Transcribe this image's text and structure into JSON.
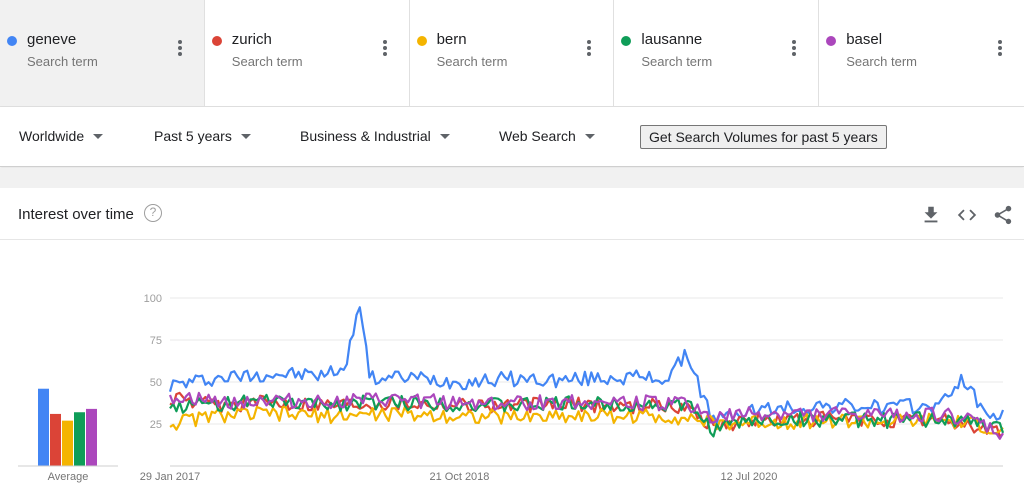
{
  "terms": [
    {
      "name": "geneve",
      "sub": "Search term",
      "color": "#4285f4"
    },
    {
      "name": "zurich",
      "sub": "Search term",
      "color": "#db4437"
    },
    {
      "name": "bern",
      "sub": "Search term",
      "color": "#f4b400"
    },
    {
      "name": "lausanne",
      "sub": "Search term",
      "color": "#0f9d58"
    },
    {
      "name": "basel",
      "sub": "Search term",
      "color": "#ab47bc"
    }
  ],
  "filters": {
    "region": "Worldwide",
    "period": "Past 5 years",
    "category": "Business & Industrial",
    "property": "Web Search"
  },
  "volume_button": "Get Search Volumes for past 5 years",
  "card": {
    "title": "Interest over time",
    "help": "?",
    "icons": [
      "download-icon",
      "embed-icon",
      "share-icon"
    ]
  },
  "chart_data": {
    "type": "line",
    "ylim": [
      0,
      100
    ],
    "yticks": [
      25,
      50,
      75,
      100
    ],
    "x_tick_labels": [
      "29 Jan 2017",
      "21 Oct 2018",
      "12 Jul 2020"
    ],
    "x_tick_dates": [
      "2017-01-29",
      "2018-10-21",
      "2020-07-12"
    ],
    "x_start": "2017-01-29",
    "x_end": "2022-01-16",
    "average_label": "Average",
    "averages": [
      {
        "name": "geneve",
        "value": 46
      },
      {
        "name": "zurich",
        "value": 31
      },
      {
        "name": "bern",
        "value": 27
      },
      {
        "name": "lausanne",
        "value": 32
      },
      {
        "name": "basel",
        "value": 34
      }
    ],
    "series": [
      {
        "name": "geneve",
        "color": "#4285f4",
        "points": [
          [
            "2017-01-29",
            48
          ],
          [
            "2017-05-01",
            52
          ],
          [
            "2017-09-01",
            55
          ],
          [
            "2018-01-01",
            54
          ],
          [
            "2018-02-18",
            60
          ],
          [
            "2018-03-15",
            100
          ],
          [
            "2018-04-10",
            52
          ],
          [
            "2018-07-01",
            53
          ],
          [
            "2018-10-21",
            50
          ],
          [
            "2019-02-01",
            52
          ],
          [
            "2019-06-01",
            51
          ],
          [
            "2019-10-01",
            53
          ],
          [
            "2020-01-15",
            52
          ],
          [
            "2020-03-01",
            67
          ],
          [
            "2020-03-22",
            50
          ],
          [
            "2020-04-26",
            27
          ],
          [
            "2020-07-12",
            33
          ],
          [
            "2021-01-01",
            36
          ],
          [
            "2021-05-01",
            35
          ],
          [
            "2021-09-01",
            36
          ],
          [
            "2021-10-20",
            53
          ],
          [
            "2021-12-01",
            33
          ],
          [
            "2022-01-16",
            30
          ]
        ]
      },
      {
        "name": "zurich",
        "color": "#db4437",
        "points": [
          [
            "2017-01-29",
            40
          ],
          [
            "2017-05-01",
            36
          ],
          [
            "2017-09-01",
            38
          ],
          [
            "2018-01-01",
            37
          ],
          [
            "2018-06-01",
            38
          ],
          [
            "2018-10-21",
            37
          ],
          [
            "2019-02-01",
            36
          ],
          [
            "2019-06-01",
            37
          ],
          [
            "2019-10-01",
            36
          ],
          [
            "2020-03-01",
            35
          ],
          [
            "2020-04-26",
            24
          ],
          [
            "2020-07-12",
            27
          ],
          [
            "2021-01-01",
            28
          ],
          [
            "2021-05-01",
            27
          ],
          [
            "2021-09-01",
            27
          ],
          [
            "2021-12-01",
            23
          ],
          [
            "2022-01-16",
            20
          ]
        ]
      },
      {
        "name": "bern",
        "color": "#f4b400",
        "points": [
          [
            "2017-01-29",
            25
          ],
          [
            "2017-05-01",
            30
          ],
          [
            "2017-09-01",
            31
          ],
          [
            "2018-01-01",
            30
          ],
          [
            "2018-06-01",
            31
          ],
          [
            "2018-10-21",
            30
          ],
          [
            "2019-02-01",
            29
          ],
          [
            "2019-06-01",
            30
          ],
          [
            "2019-10-01",
            30
          ],
          [
            "2020-03-01",
            29
          ],
          [
            "2020-04-26",
            25
          ],
          [
            "2020-07-12",
            26
          ],
          [
            "2021-01-01",
            27
          ],
          [
            "2021-05-01",
            26
          ],
          [
            "2021-09-01",
            27
          ],
          [
            "2021-12-01",
            24
          ],
          [
            "2022-01-16",
            20
          ]
        ]
      },
      {
        "name": "lausanne",
        "color": "#0f9d58",
        "points": [
          [
            "2017-01-29",
            35
          ],
          [
            "2017-05-01",
            37
          ],
          [
            "2017-09-01",
            38
          ],
          [
            "2018-01-01",
            37
          ],
          [
            "2018-06-01",
            38
          ],
          [
            "2018-10-21",
            37
          ],
          [
            "2019-02-01",
            36
          ],
          [
            "2019-06-01",
            37
          ],
          [
            "2019-10-01",
            37
          ],
          [
            "2020-03-01",
            36
          ],
          [
            "2020-04-26",
            22
          ],
          [
            "2020-07-12",
            27
          ],
          [
            "2021-01-01",
            28
          ],
          [
            "2021-05-01",
            27
          ],
          [
            "2021-09-01",
            28
          ],
          [
            "2021-12-01",
            25
          ],
          [
            "2022-01-16",
            22
          ]
        ]
      },
      {
        "name": "basel",
        "color": "#ab47bc",
        "points": [
          [
            "2017-01-29",
            42
          ],
          [
            "2017-05-01",
            38
          ],
          [
            "2017-09-01",
            39
          ],
          [
            "2018-01-01",
            38
          ],
          [
            "2018-06-01",
            39
          ],
          [
            "2018-10-21",
            38
          ],
          [
            "2019-02-01",
            37
          ],
          [
            "2019-06-01",
            38
          ],
          [
            "2019-10-01",
            38
          ],
          [
            "2020-03-01",
            37
          ],
          [
            "2020-04-26",
            28
          ],
          [
            "2020-07-12",
            31
          ],
          [
            "2021-01-01",
            31
          ],
          [
            "2021-05-01",
            30
          ],
          [
            "2021-09-01",
            31
          ],
          [
            "2021-12-01",
            25
          ],
          [
            "2022-01-16",
            18
          ]
        ]
      }
    ]
  }
}
